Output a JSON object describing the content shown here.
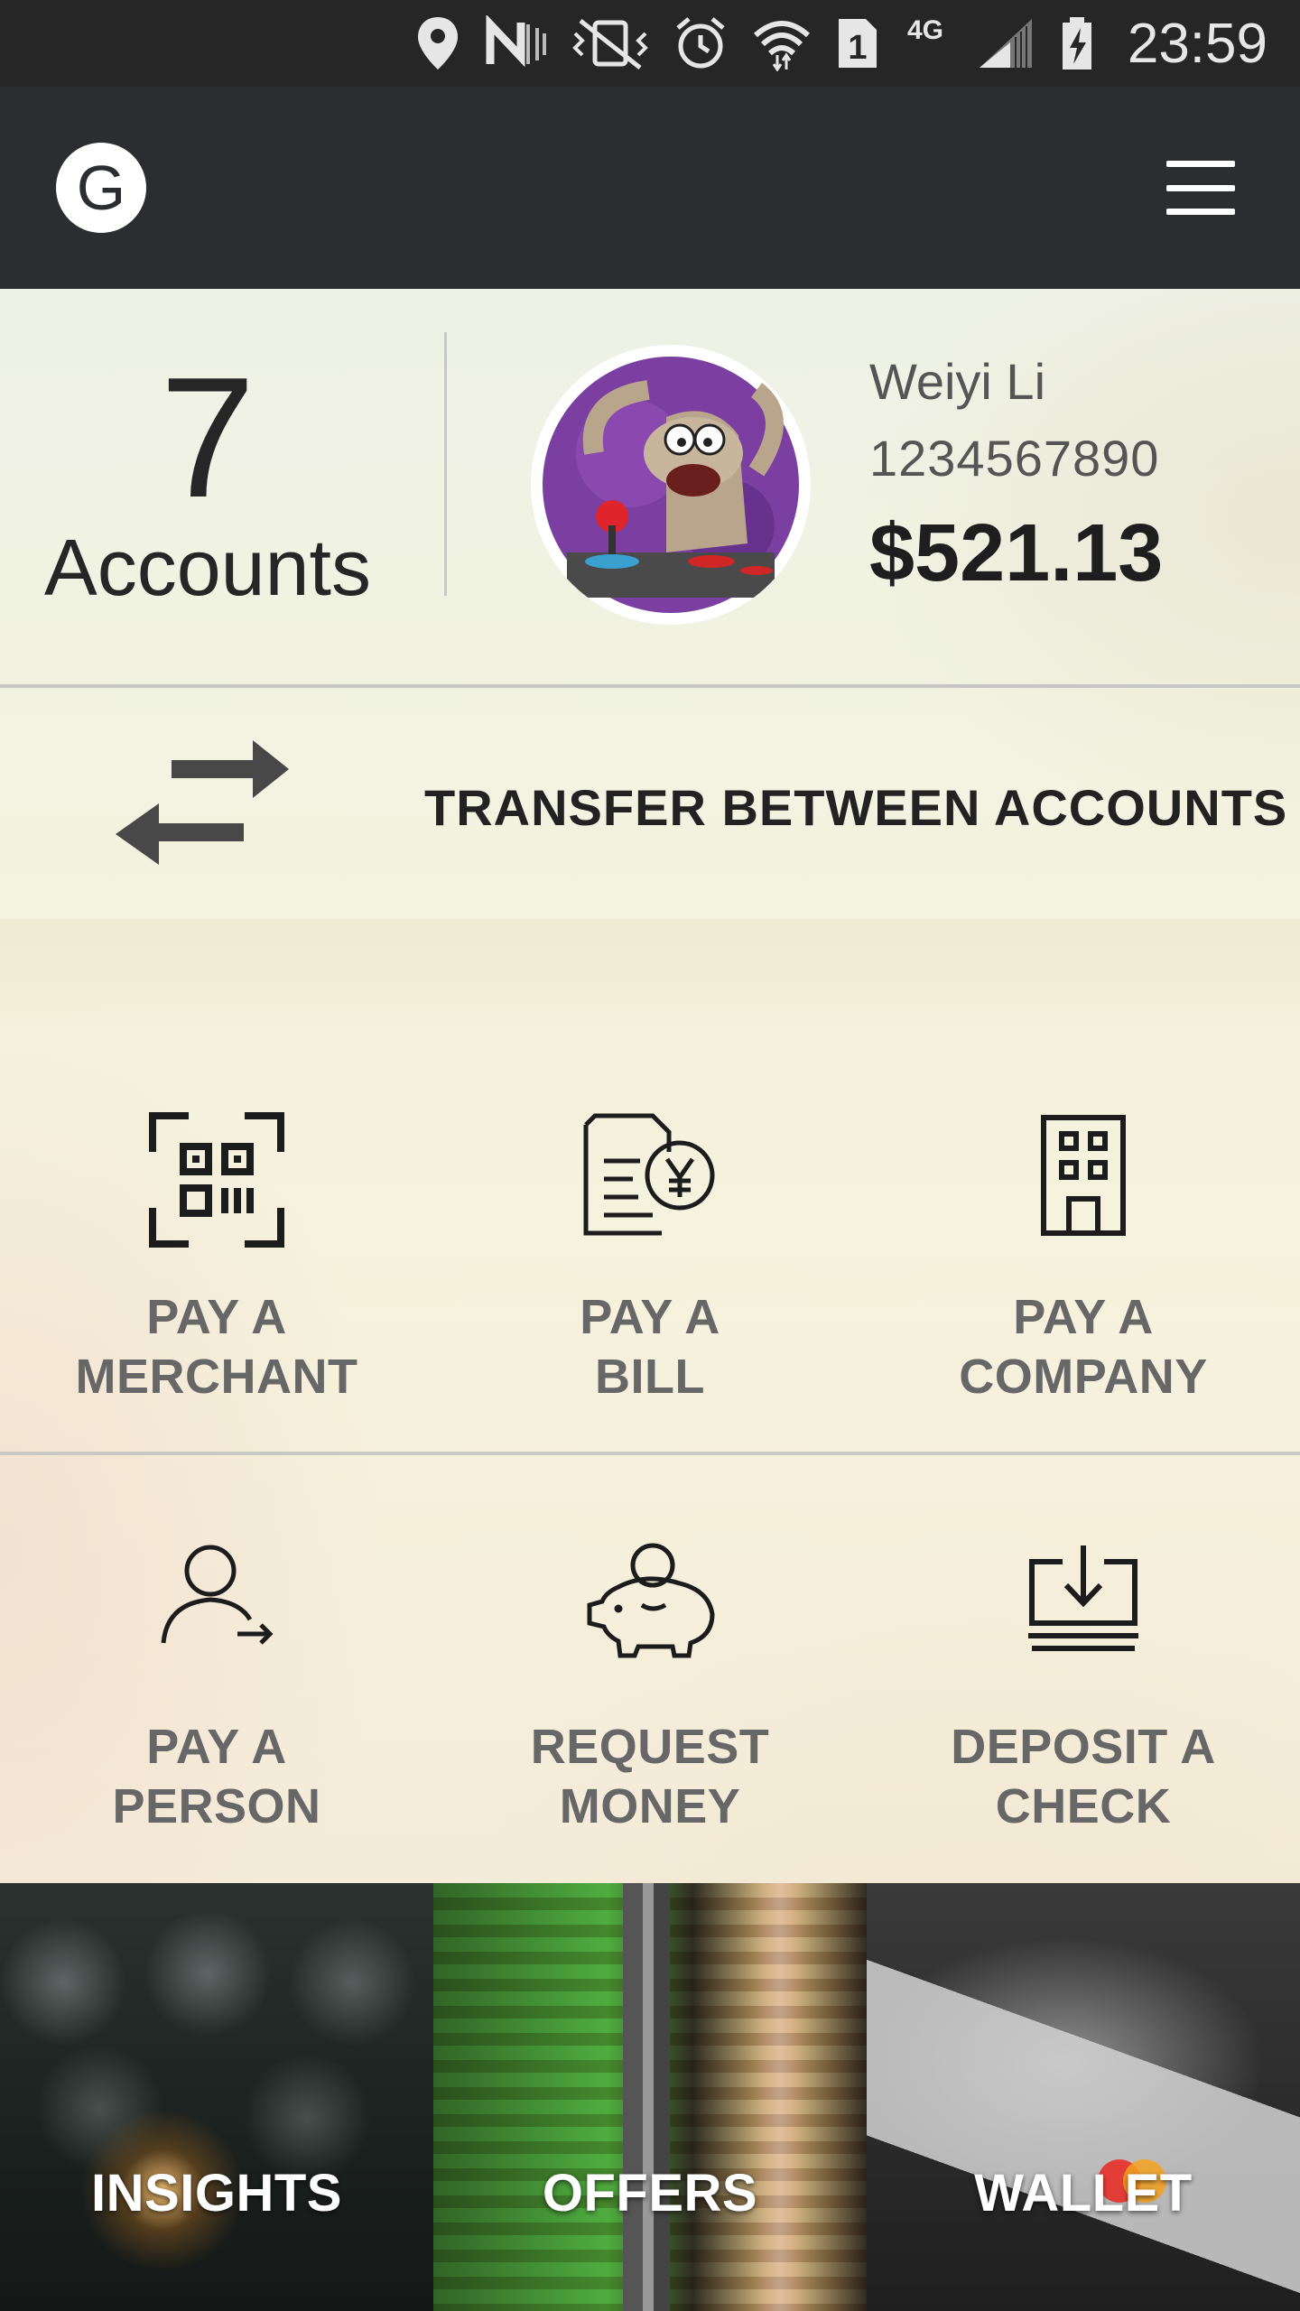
{
  "status_bar": {
    "time": "23:59",
    "icons": [
      "location-icon",
      "nfc-icon",
      "vibrate-icon",
      "alarm-icon",
      "wifi-icon",
      "sim-1-icon",
      "network-4g-icon",
      "signal-icon",
      "battery-charging-icon"
    ],
    "network_label": "4G",
    "sim_label": "1"
  },
  "app_bar": {
    "logo_letter": "G",
    "menu_icon": "hamburger-menu-icon"
  },
  "summary": {
    "accounts_count": "7",
    "accounts_label": "Accounts",
    "user_name": "Weiyi Li",
    "user_phone": "1234567890",
    "balance": "$521.13"
  },
  "transfer": {
    "label": "TRANSFER BETWEEN ACCOUNTS",
    "icon": "transfer-arrows-icon"
  },
  "actions_row1": [
    {
      "line1": "PAY A",
      "line2": "MERCHANT",
      "icon": "qr-code-icon"
    },
    {
      "line1": "PAY A",
      "line2": "BILL",
      "icon": "bill-yen-icon"
    },
    {
      "line1": "PAY A",
      "line2": "COMPANY",
      "icon": "building-icon"
    }
  ],
  "actions_row2": [
    {
      "line1": "PAY A",
      "line2": "PERSON",
      "icon": "person-arrow-icon"
    },
    {
      "line1": "REQUEST",
      "line2": "MONEY",
      "icon": "piggy-bank-icon"
    },
    {
      "line1": "DEPOSIT A",
      "line2": "CHECK",
      "icon": "deposit-tray-icon"
    }
  ],
  "tiles": [
    {
      "label": "INSIGHTS"
    },
    {
      "label": "OFFERS"
    },
    {
      "label": "WALLET"
    }
  ],
  "colors": {
    "app_bar": "#2b2d30",
    "status_bar": "#262626",
    "action_label": "#676767",
    "text_dark": "#222222"
  }
}
